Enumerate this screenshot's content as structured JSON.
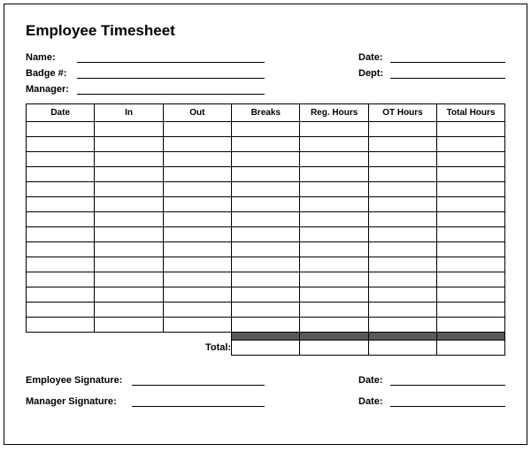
{
  "title": "Employee Timesheet",
  "header": {
    "left": [
      {
        "label": "Name:"
      },
      {
        "label": "Badge #:"
      },
      {
        "label": "Manager:"
      }
    ],
    "right": [
      {
        "label": "Date:"
      },
      {
        "label": "Dept:"
      }
    ]
  },
  "table": {
    "columns": [
      "Date",
      "In",
      "Out",
      "Breaks",
      "Reg. Hours",
      "OT Hours",
      "Total Hours"
    ],
    "row_count": 14,
    "total_label": "Total:"
  },
  "signatures": {
    "employee_label": "Employee Signature:",
    "manager_label": "Manager Signature:",
    "date_label": "Date:"
  }
}
